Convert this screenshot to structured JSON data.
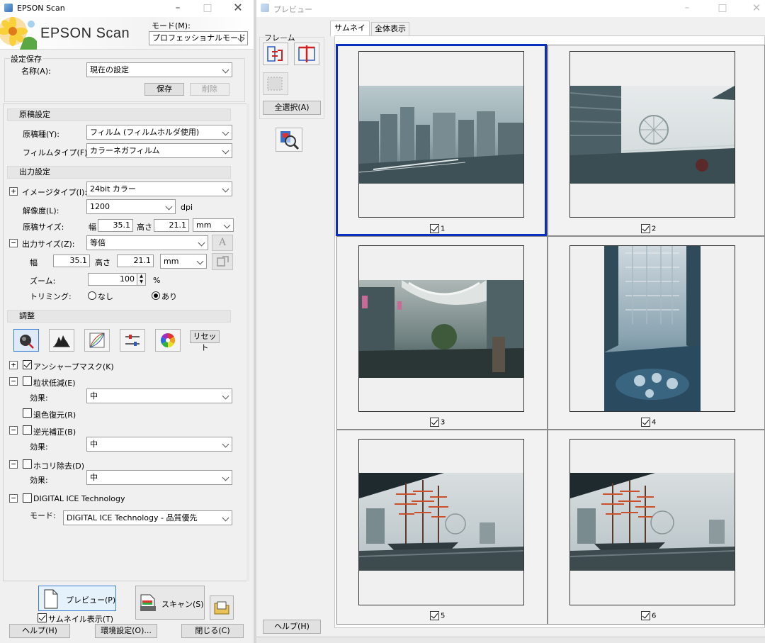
{
  "left_window": {
    "title": "EPSON Scan",
    "brand": "EPSON Scan",
    "mode_label": "モード(M):",
    "mode_value": "プロフェッショナルモード",
    "settings_save": {
      "heading": "設定保存",
      "name_label": "名称(A):",
      "name_value": "現在の設定",
      "save_button": "保存",
      "delete_button": "削除"
    },
    "original": {
      "heading": "原稿設定",
      "doc_type_label": "原稿種(Y):",
      "doc_type_value": "フィルム (フィルムホルダ使用)",
      "film_type_label": "フィルムタイプ(F):",
      "film_type_value": "カラーネガフィルム"
    },
    "output": {
      "heading": "出力設定",
      "image_type_label": "イメージタイプ(I):",
      "image_type_value": "24bit カラー",
      "resolution_label": "解像度(L):",
      "resolution_value": "1200",
      "dpi": "dpi",
      "doc_size_label": "原稿サイズ:",
      "width_label": "幅",
      "doc_width": "35.1",
      "height_label": "高さ",
      "doc_height": "21.1",
      "unit": "mm",
      "out_size_label": "出力サイズ(Z):",
      "out_size_value": "等倍",
      "out_width": "35.1",
      "out_height": "21.1",
      "out_unit": "mm",
      "zoom_label": "ズーム:",
      "zoom_value": "100",
      "zoom_unit": "%",
      "trim_label": "トリミング:",
      "trim_none": "なし",
      "trim_yes": "あり"
    },
    "adjust": {
      "heading": "調整",
      "reset_button": "リセット",
      "unsharp": "アンシャープマスク(K)",
      "grain": "粒状低減(E)",
      "grain_effect_label": "効果:",
      "grain_effect": "中",
      "fade": "退色復元(R)",
      "backlight": "逆光補正(B)",
      "backlight_effect_label": "効果:",
      "backlight_effect": "中",
      "dust": "ホコリ除去(D)",
      "dust_effect_label": "効果:",
      "dust_effect": "中",
      "ice": "DIGITAL ICE Technology",
      "ice_mode_label": "モード:",
      "ice_mode_value": "DIGITAL ICE Technology - 品質優先"
    },
    "bottom": {
      "preview_button": "プレビュー(P)",
      "thumbnail_check": "サムネイル表示(T)",
      "scan_button": "スキャン(S)",
      "help_button": "ヘルプ(H)",
      "env_button": "環境設定(O)...",
      "close_button": "閉じる(C)"
    }
  },
  "right_window": {
    "title": "プレビュー",
    "tabs": [
      "サムネイル",
      "全体表示"
    ],
    "frame_label": "フレーム",
    "select_all_button": "全選択(A)",
    "help_button": "ヘルプ(H)",
    "thumbnails": [
      {
        "number": "1",
        "checked": true,
        "selected": true
      },
      {
        "number": "2",
        "checked": true,
        "selected": false
      },
      {
        "number": "3",
        "checked": true,
        "selected": false
      },
      {
        "number": "4",
        "checked": true,
        "selected": false
      },
      {
        "number": "5",
        "checked": true,
        "selected": false
      },
      {
        "number": "6",
        "checked": true,
        "selected": false
      }
    ]
  },
  "colors": {
    "selection_border": "#0a2fbf",
    "active_button": "#3c7fd6"
  }
}
